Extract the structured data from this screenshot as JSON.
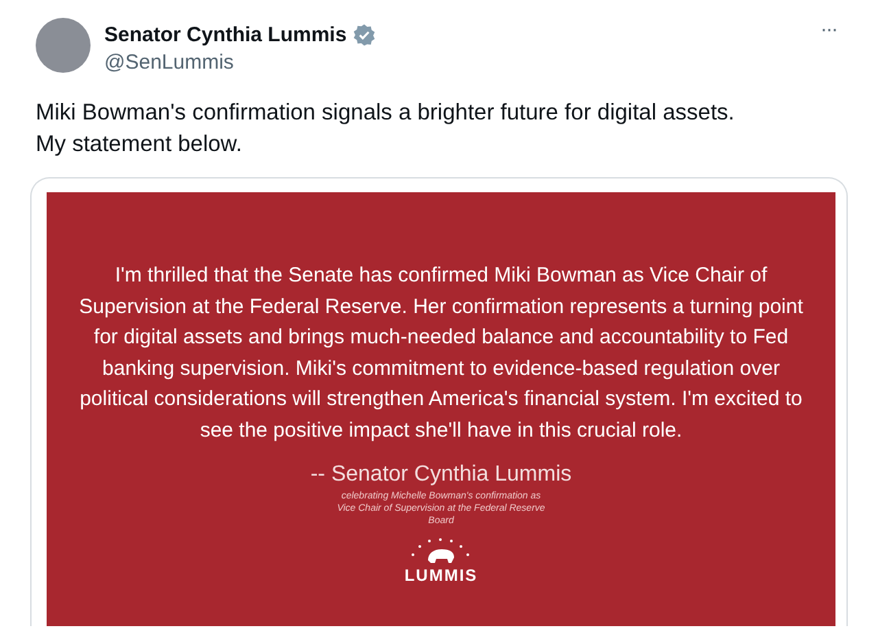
{
  "author": {
    "name": "Senator Cynthia Lummis",
    "verified": true,
    "handle": "@SenLummis"
  },
  "more_menu": "···",
  "text": "Miki Bowman's confirmation signals a brighter future for digital assets. My statement below.",
  "statement_image": {
    "quote": "I'm thrilled that the Senate has confirmed Miki Bowman as Vice Chair of Supervision at the Federal Reserve. Her confirmation represents a turning point for digital assets and brings much-needed balance and accountability to Fed banking supervision. Miki's commitment to evidence-based regulation over political considerations will strengthen America's financial system. I'm excited to see the positive impact she'll have in this crucial role.",
    "signature": "-- Senator Cynthia Lummis",
    "caption": "celebrating Michelle Bowman's confirmation as Vice Chair of Supervision at the Federal Reserve Board",
    "logo_text": "LUMMIS"
  }
}
